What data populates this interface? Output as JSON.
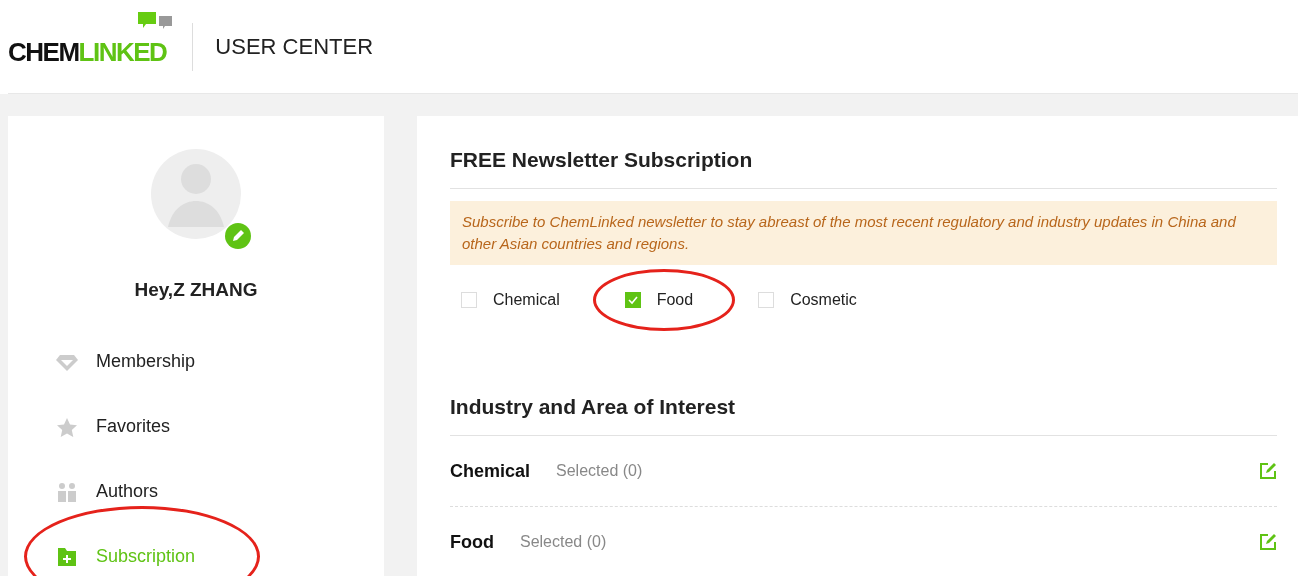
{
  "header": {
    "logo": {
      "dark": "CHEM",
      "accent": "LINKED"
    },
    "title": "USER CENTER"
  },
  "sidebar": {
    "greeting": "Hey,Z ZHANG",
    "items": [
      {
        "label": "Membership",
        "kind": "diamond",
        "selected": false,
        "circled": false
      },
      {
        "label": "Favorites",
        "kind": "star",
        "selected": false,
        "circled": false
      },
      {
        "label": "Authors",
        "kind": "people",
        "selected": false,
        "circled": false
      },
      {
        "label": "Subscription",
        "kind": "folder",
        "selected": true,
        "circled": true
      }
    ]
  },
  "newsletter": {
    "title": "FREE Newsletter Subscription",
    "notice": "Subscribe to ChemLinked newsletter to stay abreast of the most recent regulatory and industry updates in China and other Asian countries and regions.",
    "options": [
      {
        "label": "Chemical",
        "checked": false,
        "circled": false
      },
      {
        "label": "Food",
        "checked": true,
        "circled": true
      },
      {
        "label": "Cosmetic",
        "checked": false,
        "circled": false
      }
    ]
  },
  "interests": {
    "title": "Industry and Area of Interest",
    "rows": [
      {
        "name": "Chemical",
        "count": "Selected (0)"
      },
      {
        "name": "Food",
        "count": "Selected (0)"
      }
    ]
  }
}
